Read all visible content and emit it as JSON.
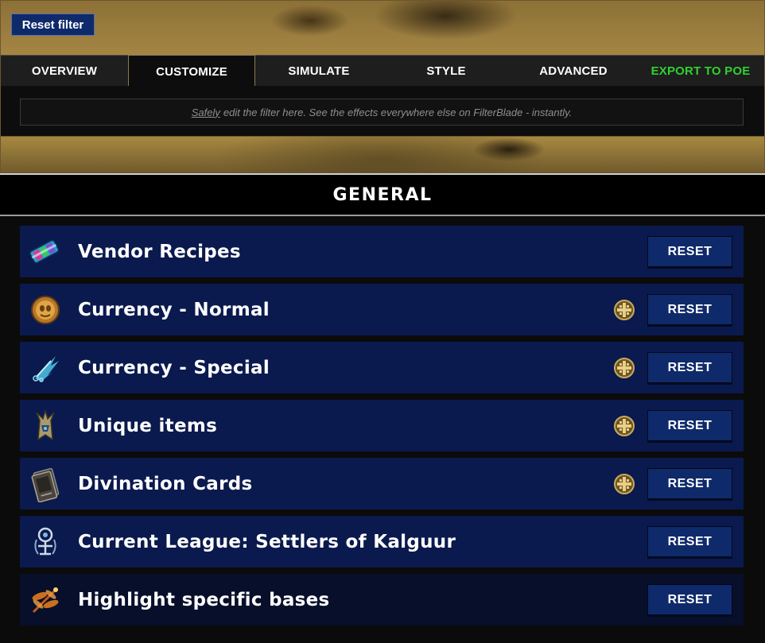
{
  "header": {
    "reset_filter_label": "Reset filter",
    "tabs": [
      {
        "label": "OVERVIEW"
      },
      {
        "label": "CUSTOMIZE"
      },
      {
        "label": "SIMULATE"
      },
      {
        "label": "STYLE"
      },
      {
        "label": "ADVANCED"
      },
      {
        "label": "EXPORT TO POE"
      }
    ],
    "active_tab": "CUSTOMIZE",
    "hint_emphasis": "Safely",
    "hint_rest": "edit the filter here. See the effects everywhere else on FilterBlade - instantly."
  },
  "section": {
    "title": "GENERAL",
    "rows": [
      {
        "label": "Vendor Recipes",
        "icon": "vendor-recipe-icon",
        "badge": false,
        "reset_label": "RESET"
      },
      {
        "label": "Currency - Normal",
        "icon": "exalted-orb-icon",
        "badge": true,
        "reset_label": "RESET"
      },
      {
        "label": "Currency - Special",
        "icon": "claw-shard-icon",
        "badge": true,
        "reset_label": "RESET"
      },
      {
        "label": "Unique items",
        "icon": "unique-helmet-icon",
        "badge": true,
        "reset_label": "RESET"
      },
      {
        "label": "Divination Cards",
        "icon": "divination-card-icon",
        "badge": true,
        "reset_label": "RESET"
      },
      {
        "label": "Current League: Settlers of Kalguur",
        "icon": "league-emblem-icon",
        "badge": false,
        "reset_label": "RESET"
      },
      {
        "label": "Highlight specific bases",
        "icon": "dragonfly-icon",
        "badge": false,
        "reset_label": "RESET"
      }
    ]
  },
  "colors": {
    "row_bg": "#0a1a4e",
    "button_bg": "#0f2a6a",
    "export_green": "#2fd12f",
    "gold_banner": "#b49249"
  }
}
